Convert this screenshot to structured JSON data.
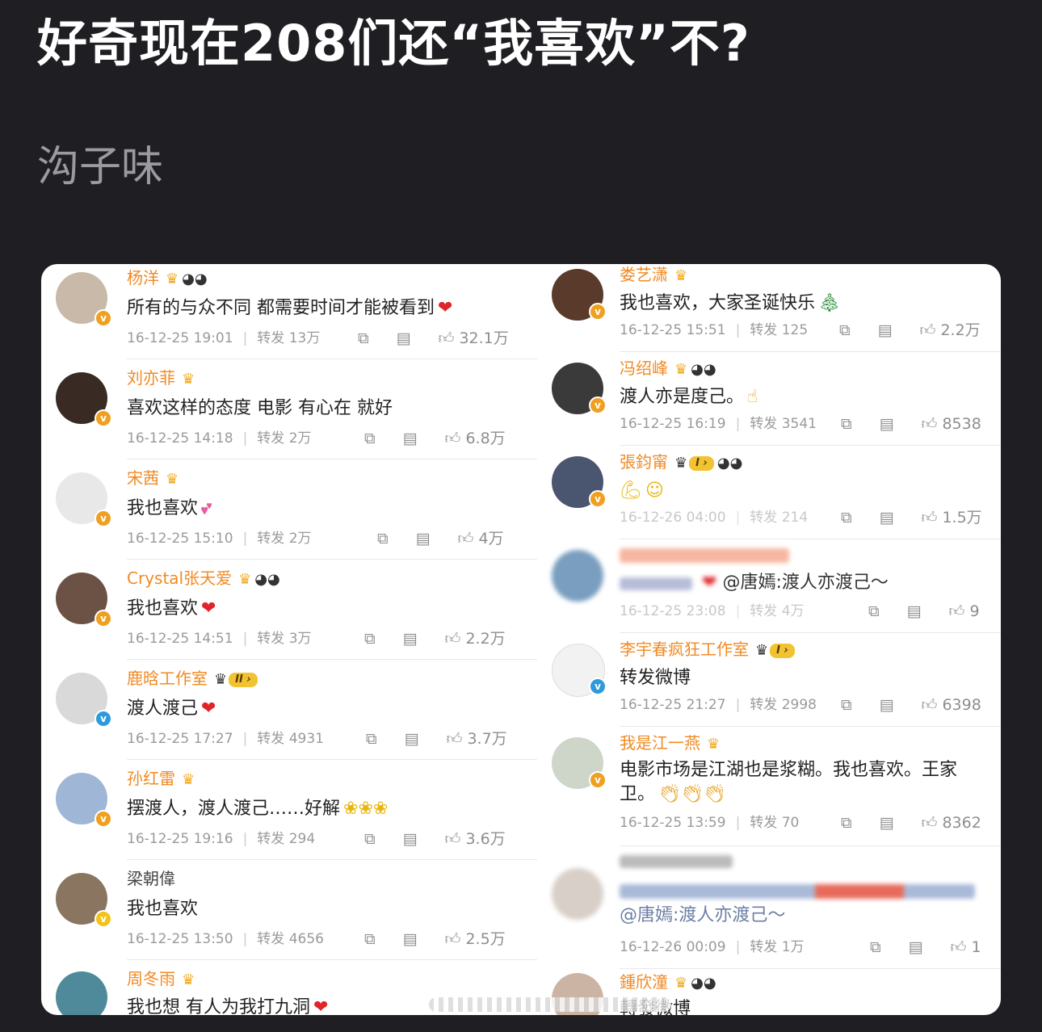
{
  "post": {
    "title": "好奇现在208们还“我喜欢”不?",
    "subtitle": "沟子味"
  },
  "left": [
    {
      "name": "杨洋",
      "text": "所有的与众不同 都需要时间才能被看到",
      "time": "16-12-25 19:01",
      "repost": "转发 13万",
      "likes": "32.1万",
      "badge": "crown-panda"
    },
    {
      "name": "刘亦菲",
      "text": "喜欢这样的态度 电影 有心在 就好",
      "time": "16-12-25 14:18",
      "repost": "转发 2万",
      "likes": "6.8万",
      "badge": "crown"
    },
    {
      "name": "宋茜",
      "text": "我也喜欢",
      "time": "16-12-25 15:10",
      "repost": "转发 2万",
      "likes": "4万",
      "badge": "crown"
    },
    {
      "name": "Crystal张天爱",
      "text": "我也喜欢",
      "time": "16-12-25 14:51",
      "repost": "转发 3万",
      "likes": "2.2万",
      "badge": "crown-panda"
    },
    {
      "name": "鹿晗工作室",
      "text": "渡人渡己",
      "time": "16-12-25 17:27",
      "repost": "转发 4931",
      "likes": "3.7万",
      "badge": "crown-level"
    },
    {
      "name": "孙红雷",
      "text": "摆渡人，渡人渡己……好解",
      "time": "16-12-25 19:16",
      "repost": "转发 294",
      "likes": "3.6万",
      "badge": "crown"
    },
    {
      "name": "梁朝偉",
      "text": "我也喜欢",
      "time": "16-12-25 13:50",
      "repost": "转发 4656",
      "likes": "2.5万",
      "badge": ""
    },
    {
      "name": "周冬雨",
      "text": "我也想 有人为我打九洞",
      "time": "",
      "repost": "",
      "likes": "",
      "badge": "crown"
    }
  ],
  "right": [
    {
      "name": "娄艺潇",
      "text": "我也喜欢，大家圣诞快乐",
      "time": "16-12-25 15:51",
      "repost": "转发 125",
      "likes": "2.2万",
      "badge": "crown"
    },
    {
      "name": "冯绍峰",
      "text": "渡人亦是度己。",
      "time": "16-12-25 16:19",
      "repost": "转发 3541",
      "likes": "8538",
      "badge": "crown-panda"
    },
    {
      "name": "張鈞甯",
      "text": "",
      "time": "16-12-26 04:00",
      "repost": "转发 214",
      "likes": "1.5万",
      "badge": "crown-level-panda"
    },
    {
      "name": "",
      "text": "@唐嫣:渡人亦渡己～",
      "time": "16-12-25 23:08",
      "repost": "转发 4万",
      "likes": "9",
      "badge": ""
    },
    {
      "name": "李宇春疯狂工作室",
      "text": "转发微博",
      "time": "16-12-25 21:27",
      "repost": "转发 2998",
      "likes": "6398",
      "badge": "crown-level"
    },
    {
      "name": "我是江一燕",
      "text": "电影市场是江湖也是浆糊。我也喜欢。王家卫。",
      "time": "16-12-25 13:59",
      "repost": "转发 70",
      "likes": "8362",
      "badge": "crown"
    },
    {
      "name": "",
      "text": "@唐嫣:渡人亦渡己～",
      "time": "16-12-26 00:09",
      "repost": "转发 1万",
      "likes": "1",
      "badge": ""
    },
    {
      "name": "鍾欣潼",
      "text": "轉發微博",
      "time": "",
      "repost": "",
      "likes": "",
      "badge": "crown-panda"
    }
  ],
  "icons": {
    "share": "share-icon",
    "comment": "comment-icon",
    "like": "thumbs-up-icon"
  },
  "colors": {
    "name": "#f08a24",
    "background": "#1f1f23",
    "card": "#ffffff"
  }
}
